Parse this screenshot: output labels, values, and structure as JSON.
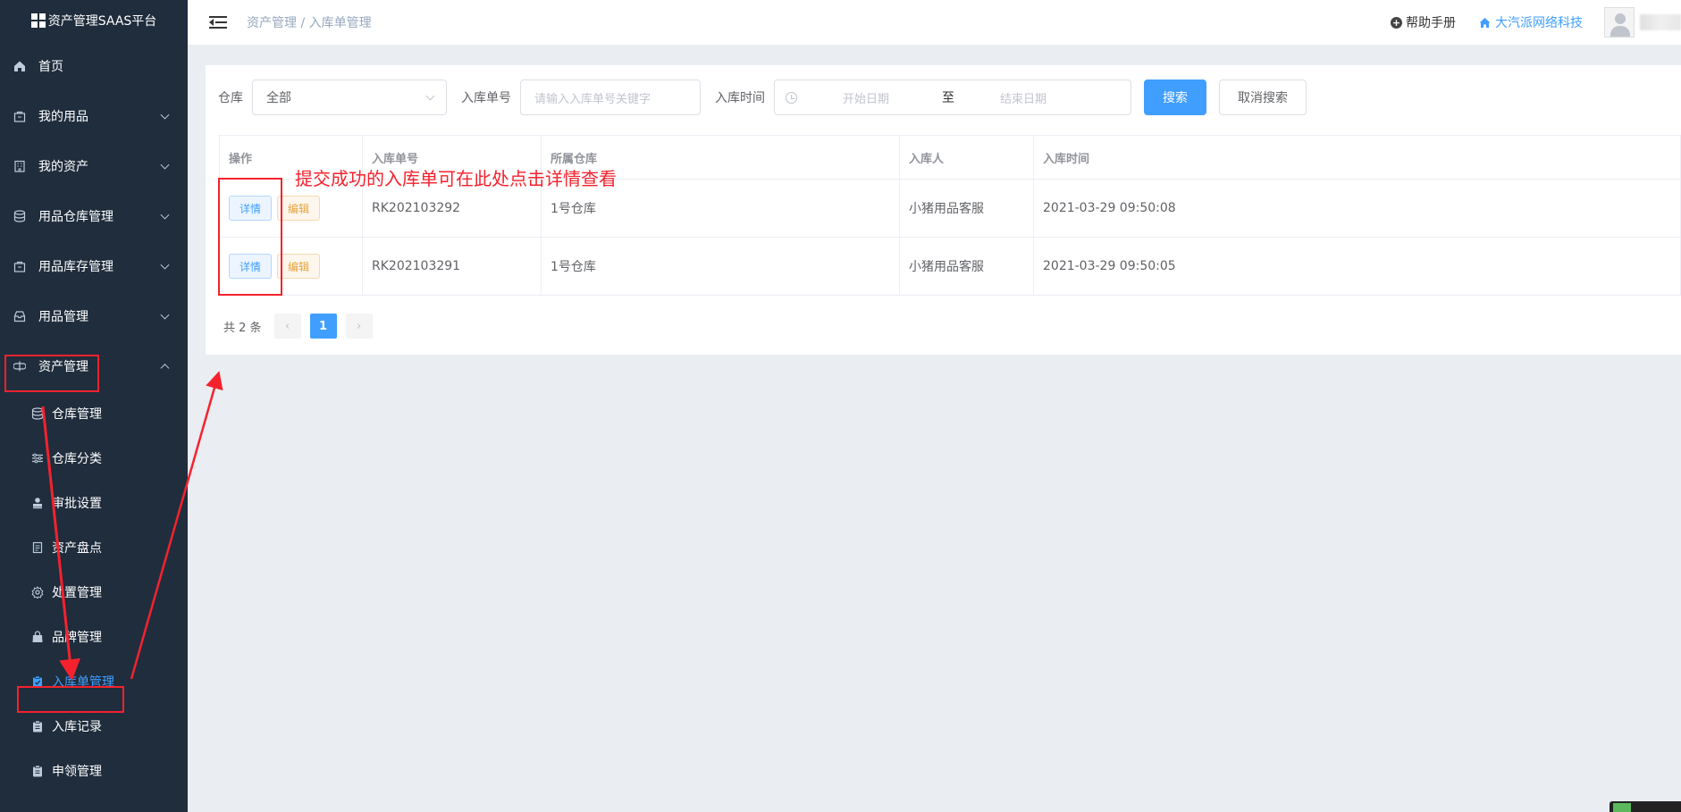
{
  "app": {
    "title": "资产管理SAAS平台"
  },
  "sidebar": {
    "items": [
      {
        "label": "首页",
        "icon": "home-icon",
        "has_arrow": false
      },
      {
        "label": "我的用品",
        "icon": "bag-icon",
        "has_arrow": true
      },
      {
        "label": "我的资产",
        "icon": "building-icon",
        "has_arrow": true
      },
      {
        "label": "用品仓库管理",
        "icon": "database-icon",
        "has_arrow": true
      },
      {
        "label": "用品库存管理",
        "icon": "bag-icon",
        "has_arrow": true
      },
      {
        "label": "用品管理",
        "icon": "inbox-icon",
        "has_arrow": true
      },
      {
        "label": "资产管理",
        "icon": "asset-icon",
        "has_arrow": true,
        "expanded": true
      }
    ],
    "sub_items": [
      {
        "label": "仓库管理",
        "icon": "database-icon"
      },
      {
        "label": "仓库分类",
        "icon": "sliders-icon"
      },
      {
        "label": "审批设置",
        "icon": "stamp-icon"
      },
      {
        "label": "资产盘点",
        "icon": "document-icon"
      },
      {
        "label": "处置管理",
        "icon": "gear-icon"
      },
      {
        "label": "品牌管理",
        "icon": "shop-icon"
      },
      {
        "label": "入库单管理",
        "icon": "clipboard-check-icon",
        "active": true
      },
      {
        "label": "入库记录",
        "icon": "clipboard-icon"
      },
      {
        "label": "申领管理",
        "icon": "clipboard-icon"
      }
    ]
  },
  "header": {
    "breadcrumb": "资产管理 / 入库单管理",
    "help_label": "帮助手册",
    "company_label": "大汽派网络科技"
  },
  "filter": {
    "warehouse_label": "仓库",
    "warehouse_value": "全部",
    "order_no_label": "入库单号",
    "order_no_placeholder": "请输入入库单号关键字",
    "time_label": "入库时间",
    "start_placeholder": "开始日期",
    "range_separator": "至",
    "end_placeholder": "结束日期",
    "search_button": "搜索",
    "cancel_button": "取消搜索"
  },
  "table": {
    "columns": [
      "操作",
      "入库单号",
      "所属仓库",
      "入库人",
      "入库时间"
    ],
    "rows": [
      {
        "detail": "详情",
        "edit": "编辑",
        "order_no": "RK202103292",
        "warehouse": "1号仓库",
        "operator": "小猪用品客服",
        "time": "2021-03-29 09:50:08"
      },
      {
        "detail": "详情",
        "edit": "编辑",
        "order_no": "RK202103291",
        "warehouse": "1号仓库",
        "operator": "小猪用品客服",
        "time": "2021-03-29 09:50:05"
      }
    ]
  },
  "pagination": {
    "total_text": "共 2 条",
    "prev": "‹",
    "current_page": "1",
    "next": "›"
  },
  "annotation": {
    "text": "提交成功的入库单可在此处点击详情查看",
    "color": "#f5222d"
  },
  "colors": {
    "sidebar_bg": "#1f2d3d",
    "primary": "#409eff",
    "warning": "#e6a23c"
  }
}
